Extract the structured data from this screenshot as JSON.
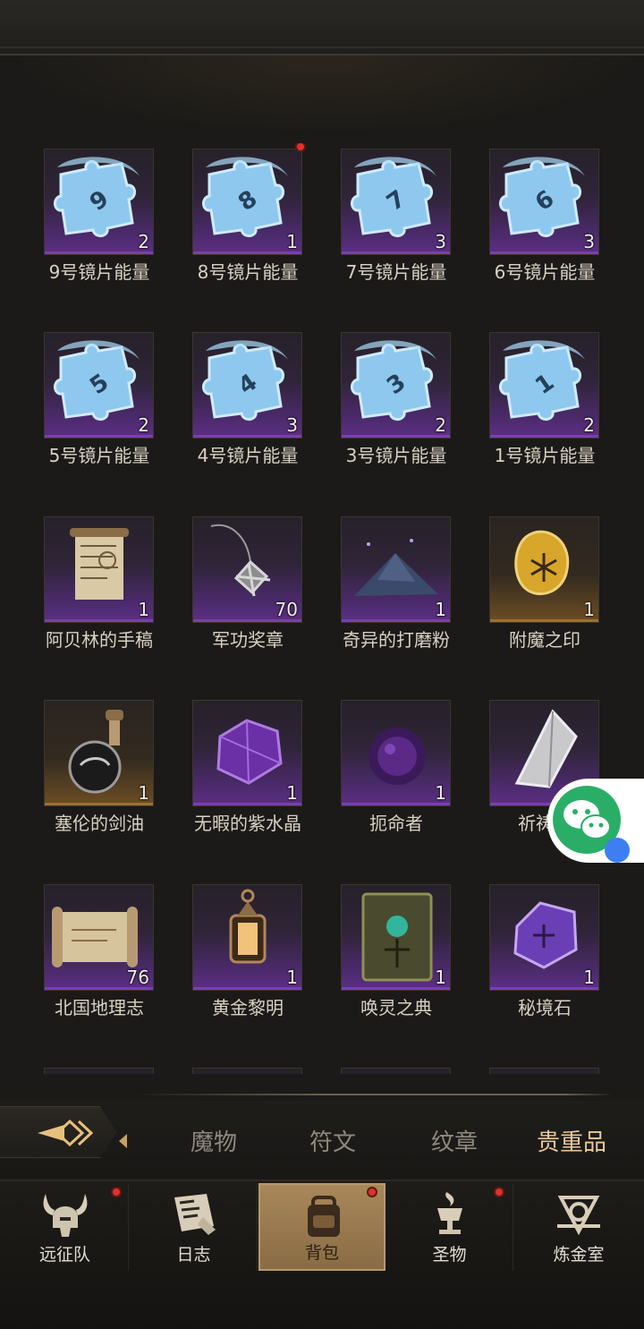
{
  "items": [
    {
      "name": "9号镜片能量",
      "count": "2",
      "icon": "puzzle-piece-icon",
      "digit": "9",
      "rarity": "epic"
    },
    {
      "name": "8号镜片能量",
      "count": "1",
      "icon": "puzzle-piece-icon",
      "digit": "8",
      "rarity": "epic",
      "badge": true
    },
    {
      "name": "7号镜片能量",
      "count": "3",
      "icon": "puzzle-piece-icon",
      "digit": "7",
      "rarity": "epic"
    },
    {
      "name": "6号镜片能量",
      "count": "3",
      "icon": "puzzle-piece-icon",
      "digit": "6",
      "rarity": "epic"
    },
    {
      "name": "5号镜片能量",
      "count": "2",
      "icon": "puzzle-piece-icon",
      "digit": "5",
      "rarity": "epic"
    },
    {
      "name": "4号镜片能量",
      "count": "3",
      "icon": "puzzle-piece-icon",
      "digit": "4",
      "rarity": "epic"
    },
    {
      "name": "3号镜片能量",
      "count": "2",
      "icon": "puzzle-piece-icon",
      "digit": "3",
      "rarity": "epic"
    },
    {
      "name": "1号镜片能量",
      "count": "2",
      "icon": "puzzle-piece-icon",
      "digit": "1",
      "rarity": "epic"
    },
    {
      "name": "阿贝林的手稿",
      "count": "1",
      "icon": "scroll-manuscript-icon",
      "rarity": "epic"
    },
    {
      "name": "军功奖章",
      "count": "70",
      "icon": "medal-icon",
      "rarity": "epic"
    },
    {
      "name": "奇异的打磨粉",
      "count": "1",
      "icon": "powder-pile-icon",
      "rarity": "epic"
    },
    {
      "name": "附魔之印",
      "count": "1",
      "icon": "enchant-seal-icon",
      "rarity": "legend"
    },
    {
      "name": "塞伦的剑油",
      "count": "1",
      "icon": "oil-flask-icon",
      "rarity": "legend"
    },
    {
      "name": "无暇的紫水晶",
      "count": "1",
      "icon": "amethyst-icon",
      "rarity": "epic"
    },
    {
      "name": "扼命者",
      "count": "1",
      "icon": "dark-orb-icon",
      "rarity": "epic"
    },
    {
      "name": "祈祷者",
      "count": "",
      "icon": "silver-shard-icon",
      "rarity": "epic"
    },
    {
      "name": "北国地理志",
      "count": "76",
      "icon": "map-scroll-icon",
      "rarity": "epic"
    },
    {
      "name": "黄金黎明",
      "count": "1",
      "icon": "lantern-icon",
      "rarity": "epic"
    },
    {
      "name": "唤灵之典",
      "count": "1",
      "icon": "tome-icon",
      "rarity": "epic"
    },
    {
      "name": "秘境石",
      "count": "1",
      "icon": "purple-stone-icon",
      "rarity": "epic"
    }
  ],
  "tabs": [
    {
      "label": "魔物",
      "active": false
    },
    {
      "label": "符文",
      "active": false
    },
    {
      "label": "纹章",
      "active": false
    },
    {
      "label": "贵重品",
      "active": true
    }
  ],
  "nav": [
    {
      "label": "远征队",
      "icon": "horned-helmet-icon",
      "badge": true,
      "active": false
    },
    {
      "label": "日志",
      "icon": "journal-icon",
      "badge": false,
      "active": false
    },
    {
      "label": "背包",
      "icon": "backpack-icon",
      "badge": true,
      "active": true
    },
    {
      "label": "圣物",
      "icon": "chalice-icon",
      "badge": true,
      "active": false
    },
    {
      "label": "炼金室",
      "icon": "alchemy-icon",
      "badge": false,
      "active": false
    }
  ],
  "colors": {
    "epic": "#5d2f86",
    "legend": "#6e4d22",
    "active_tab": "#e9c998",
    "badge": "#e0312e"
  }
}
